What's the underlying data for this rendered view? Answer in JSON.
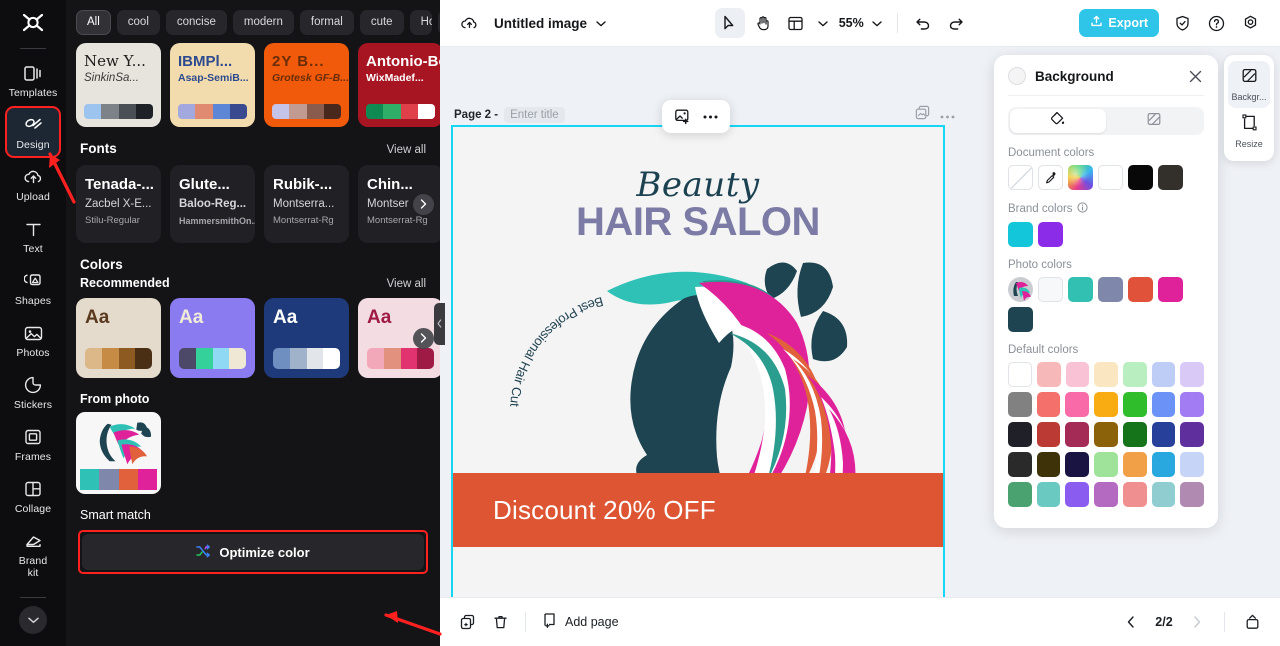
{
  "left_rail": {
    "logo_name": "capcut-logo",
    "items": [
      {
        "label": "Templates",
        "icon": "templates-icon",
        "active": false
      },
      {
        "label": "Design",
        "icon": "design-icon",
        "active": true
      },
      {
        "label": "Upload",
        "icon": "upload-cloud-icon",
        "active": false
      },
      {
        "label": "Text",
        "icon": "text-icon",
        "active": false
      },
      {
        "label": "Shapes",
        "icon": "shapes-icon",
        "active": false
      },
      {
        "label": "Photos",
        "icon": "photos-icon",
        "active": false
      },
      {
        "label": "Stickers",
        "icon": "stickers-icon",
        "active": false
      },
      {
        "label": "Frames",
        "icon": "frames-icon",
        "active": false
      },
      {
        "label": "Collage",
        "icon": "collage-icon",
        "active": false
      },
      {
        "label": "Brand\nkit",
        "icon": "brand-kit-icon",
        "active": false
      }
    ],
    "expand_icon": "chevron-down-icon"
  },
  "panel": {
    "chips": [
      "All",
      "cool",
      "concise",
      "modern",
      "formal",
      "cute",
      "Holi"
    ],
    "chips_more_icon": "chevron-down-icon",
    "templates": [
      {
        "line1": "New Y...",
        "line2": "SinkinSa...",
        "bg": "#e7e4dd",
        "c1": "#1c1c1c",
        "c2": "#3a3a3a",
        "swatches": [
          "#9cc4ee",
          "#7d8288",
          "#4a4f55",
          "#1e2126"
        ]
      },
      {
        "line1": "IBMPl...",
        "line2": "Asap-SemiB...",
        "bg": "#f2dcad",
        "c1": "#2e4a8f",
        "c2": "#2e4a8f",
        "swatches": [
          "#a3a9de",
          "#e08a72",
          "#5d86d6",
          "#3a4a8f"
        ]
      },
      {
        "line1": "2Y B...",
        "line2": "Grotesk GF-B...",
        "bg": "#f05a0a",
        "c1": "#6b2d08",
        "c2": "#6b2d08",
        "swatches": [
          "#c5c3e8",
          "#c19b92",
          "#8a5c4e",
          "#48281c"
        ]
      },
      {
        "line1": "Antonio-Bo",
        "line2": "WixMadef...",
        "bg": "#a81522",
        "c1": "#ffffff",
        "c2": "#ffffff",
        "swatches": [
          "#0e8a52",
          "#2fae68",
          "#e0404a",
          "#ffffff"
        ]
      }
    ],
    "fonts_section": {
      "title": "Fonts",
      "view_all": "View all"
    },
    "fonts": [
      {
        "l1": "Tenada-...",
        "l2": "Zacbel X-E...",
        "l3": "Stilu-Regular",
        "bold2": false
      },
      {
        "l1": "Glute...",
        "l2": "Baloo-Reg...",
        "l3": "HammersmithOn...",
        "bold2": true
      },
      {
        "l1": "Rubik-...",
        "l2": "Montserra...",
        "l3": "Montserrat-Rg",
        "bold2": false
      },
      {
        "l1": "Chin...",
        "l2": "Montser",
        "l3": "Montserrat-Rg",
        "bold2": false
      }
    ],
    "colors_section": {
      "title": "Colors"
    },
    "recommended_section": {
      "title": "Recommended",
      "view_all": "View all"
    },
    "recommended": [
      {
        "aa": "Aa",
        "bg": "#e4dbcd",
        "fg": "#5a3a1e",
        "swatches": [
          "#dcb787",
          "#c68b45",
          "#8d5a22",
          "#4b2f14"
        ]
      },
      {
        "aa": "Aa",
        "bg": "#8a7cf0",
        "fg": "#f1ecd8",
        "swatches": [
          "#4b4967",
          "#34d19a",
          "#8fd9f5",
          "#eee8d5"
        ]
      },
      {
        "aa": "Aa",
        "bg": "#1f3a7a",
        "fg": "#ffffff",
        "swatches": [
          "#6e8fc0",
          "#9fb2c9",
          "#e2e6ea",
          "#ffffff"
        ]
      },
      {
        "aa": "Aa",
        "bg": "#f3dde3",
        "fg": "#9f1b45",
        "swatches": [
          "#f2a8b8",
          "#e2917f",
          "#e0336f",
          "#9f1b45"
        ]
      }
    ],
    "from_photo_label": "From photo",
    "from_photo_swatches": [
      "#2fc1b6",
      "#7f88ab",
      "#e0613c",
      "#e0229a"
    ],
    "smart_match_label": "Smart match",
    "optimize_button": {
      "label": "Optimize color",
      "icon": "shuffle-icon"
    },
    "collapse_handle_icon": "chevron-left-icon"
  },
  "topbar": {
    "cloud_icon": "cloud-sync-icon",
    "doc_title": "Untitled image",
    "doc_caret_icon": "chevron-down-icon",
    "select_tool_icon": "cursor-arrow-icon",
    "hand_tool_icon": "hand-icon",
    "layout_tool_icon": "layout-icon",
    "layout_caret_icon": "chevron-down-icon",
    "zoom_value": "55%",
    "zoom_caret_icon": "chevron-down-icon",
    "undo_icon": "undo-icon",
    "redo_icon": "redo-icon",
    "export_label": "Export",
    "export_icon": "export-upload-icon",
    "export_color": "#2ec5e8",
    "shield_icon": "shield-check-icon",
    "help_icon": "help-circle-icon",
    "settings_icon": "settings-gear-icon"
  },
  "stage": {
    "page_label": "Page 2 -",
    "page_title_placeholder": "Enter title",
    "duplicate_page_icon": "duplicate-page-icon",
    "page_more_icon": "more-horizontal-icon",
    "float_toolbar": {
      "replace_image_icon": "add-image-icon",
      "more_icon": "more-horizontal-icon"
    },
    "selection_color": "#16d6f5"
  },
  "canvas_design": {
    "script_title": "Beauty",
    "main_title": "HAIR SALON",
    "arc_text": "Best Professional Hair Cut",
    "banner_text": "Discount 20% OFF",
    "banner_color": "#dd5533",
    "title_color": "#7b7ba6",
    "script_color": "#1c4251",
    "background_color": "#f4f4f4"
  },
  "bottombar": {
    "duplicate_icon": "duplicate-icon",
    "delete_icon": "trash-icon",
    "add_page_icon": "add-page-icon",
    "add_page_label": "Add page",
    "prev_icon": "chevron-left-icon",
    "next_icon": "chevron-right-icon",
    "page_indicator": "2/2",
    "collapse_icon": "collapse-up-icon"
  },
  "background_panel": {
    "title": "Background",
    "close_icon": "close-icon",
    "tab_fill_icon": "paint-bucket-icon",
    "tab_pattern_icon": "pattern-icon",
    "document_colors_label": "Document colors",
    "document_colors": [
      "none",
      "picker",
      "rainbow",
      "#ffffff",
      "#080808",
      "#33302c"
    ],
    "brand_colors_label": "Brand colors",
    "brand_colors_info_icon": "info-icon",
    "brand_colors": [
      "#13c6d9",
      "#8b2ce8"
    ],
    "photo_colors_label": "Photo colors",
    "photo_colors": [
      "thumb",
      "#f7f8f9",
      "#32c0b2",
      "#7f88ab",
      "#e0533a",
      "#e0229a",
      "#1d4450"
    ],
    "default_colors_label": "Default colors",
    "default_colors": [
      [
        "#ffffff",
        "#f6b8b8",
        "#f9c3d5",
        "#fae6c0",
        "#b9eec0",
        "#bdcdf6",
        "#d9c9f7"
      ],
      [
        "#818181",
        "#f4716b",
        "#f96aa8",
        "#f9ab12",
        "#2fbd2c",
        "#6b93f7",
        "#a17cf2"
      ],
      [
        "#202028",
        "#bc3a34",
        "#a32b55",
        "#8b6209",
        "#15731a",
        "#27409a",
        "#5f2f9e"
      ],
      [
        "#2a2a2a",
        "#3d3208",
        "#191442",
        "#9fe29a",
        "#f1a048",
        "#29a8df",
        "#c5d4f7"
      ],
      [
        "#4aa271",
        "#6ac9c0",
        "#8a5df0",
        "#b56ac2",
        "#f08f8f",
        "#8fcdd0",
        "#b08ab0"
      ]
    ]
  },
  "tool_rail": {
    "items": [
      {
        "label": "Backgr...",
        "icon": "background-icon",
        "active": true
      },
      {
        "label": "Resize",
        "icon": "resize-icon",
        "active": false
      }
    ]
  },
  "annotations": {
    "highlight_color": "#ff2020"
  }
}
